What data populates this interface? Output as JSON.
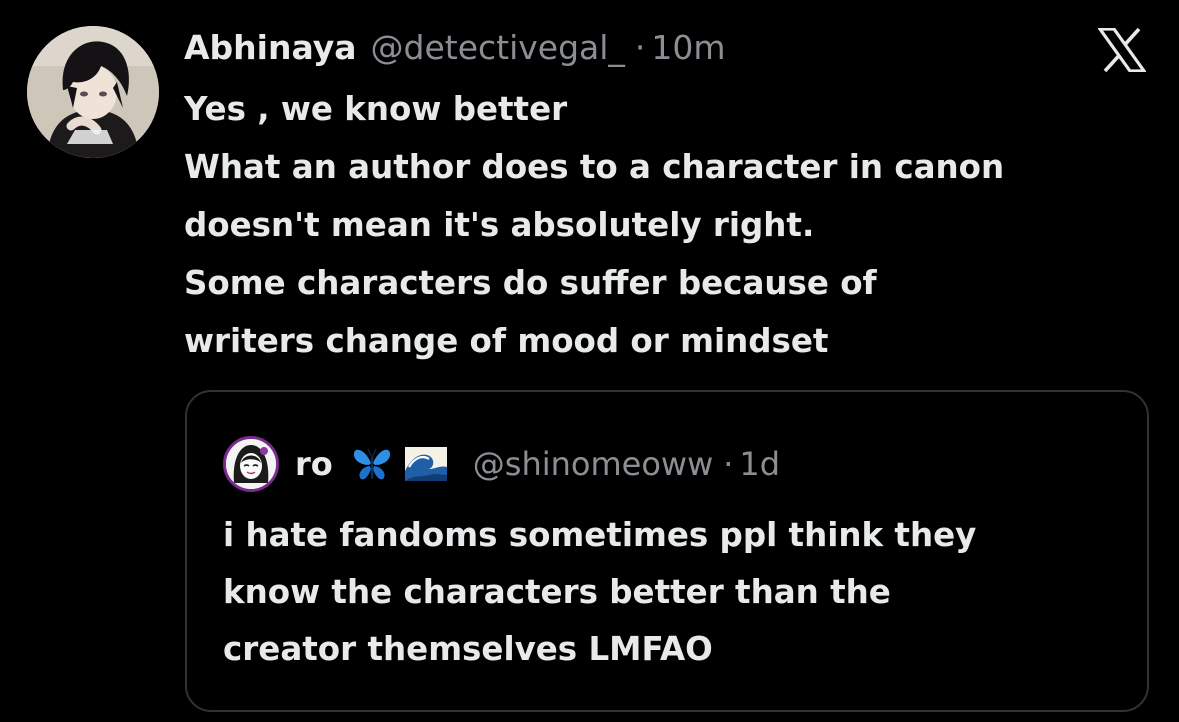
{
  "tweet": {
    "author_name": "Abhinaya",
    "author_handle": "@detectivegal_",
    "separator": "·",
    "timestamp": "10m",
    "lines": [
      "Yes , we know better",
      "What an author does to a character in canon",
      "doesn't mean it's absolutely right.",
      "Some characters do suffer because of",
      "writers change of mood or mindset"
    ]
  },
  "quoted_tweet": {
    "author_name": "ro",
    "emoji_icons": [
      "butterfly-icon",
      "wave-icon"
    ],
    "author_handle": "@shinomeoww",
    "separator": "·",
    "timestamp": "1d",
    "lines": [
      "i hate fandoms sometimes ppl think they",
      "know the characters better than the",
      "creator themselves LMFAO"
    ]
  },
  "icons": {
    "brand": "x-logo-icon"
  },
  "colors": {
    "background": "#000000",
    "primary_text": "#e7e9ea",
    "secondary_text": "#8b8f94",
    "card_border": "#2f3336",
    "quote_avatar_ring": "#7b2b8e"
  }
}
